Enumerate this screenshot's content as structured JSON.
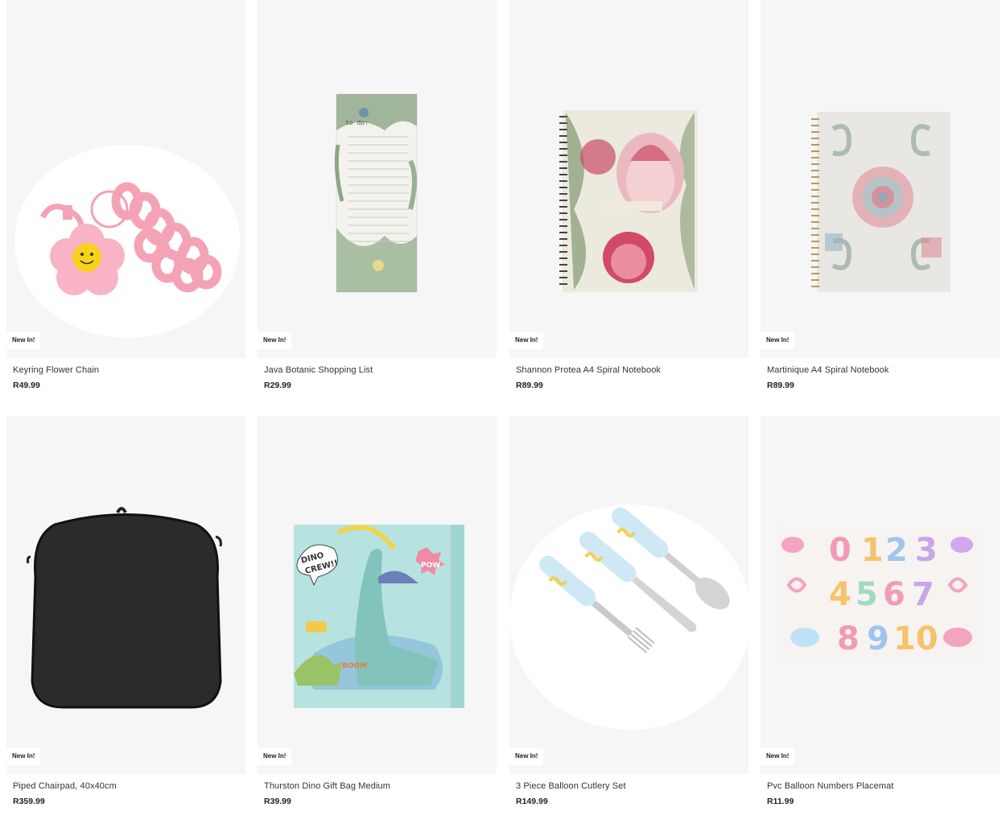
{
  "products": [
    {
      "name": "Keyring Flower Chain",
      "price": "R49.99",
      "badge": "New In!",
      "image": "keyring-flower-chain-image"
    },
    {
      "name": "Java Botanic Shopping List",
      "price": "R29.99",
      "badge": "New In!",
      "image": "java-botanic-shopping-list-image",
      "image_text": "to do:"
    },
    {
      "name": "Shannon Protea A4 Spiral Notebook",
      "price": "R89.99",
      "badge": "New In!",
      "image": "shannon-protea-notebook-image"
    },
    {
      "name": "Martinique A4 Spiral Notebook",
      "price": "R89.99",
      "badge": "New In!",
      "image": "martinique-notebook-image"
    },
    {
      "name": "Piped Chairpad, 40x40cm",
      "price": "R359.99",
      "badge": "New In!",
      "image": "piped-chairpad-image"
    },
    {
      "name": "Thurston Dino Gift Bag Medium",
      "price": "R39.99",
      "badge": "New In!",
      "image": "thurston-dino-gift-bag-image",
      "image_text": [
        "DINO",
        "CREW!!",
        "POW",
        "BOOM"
      ]
    },
    {
      "name": "3 Piece Balloon Cutlery Set",
      "price": "R149.99",
      "badge": "New In!",
      "image": "balloon-cutlery-set-image"
    },
    {
      "name": "Pvc Balloon Numbers Placemat",
      "price": "R11.99",
      "badge": "New In!",
      "image": "balloon-numbers-placemat-image",
      "image_text": [
        "0",
        "1",
        "2",
        "3",
        "4",
        "5",
        "6",
        "7",
        "8",
        "9",
        "10"
      ]
    }
  ],
  "colors": {
    "card_background": "#f6f6f6",
    "badge_background": "#ffffff",
    "text": "#222222"
  }
}
